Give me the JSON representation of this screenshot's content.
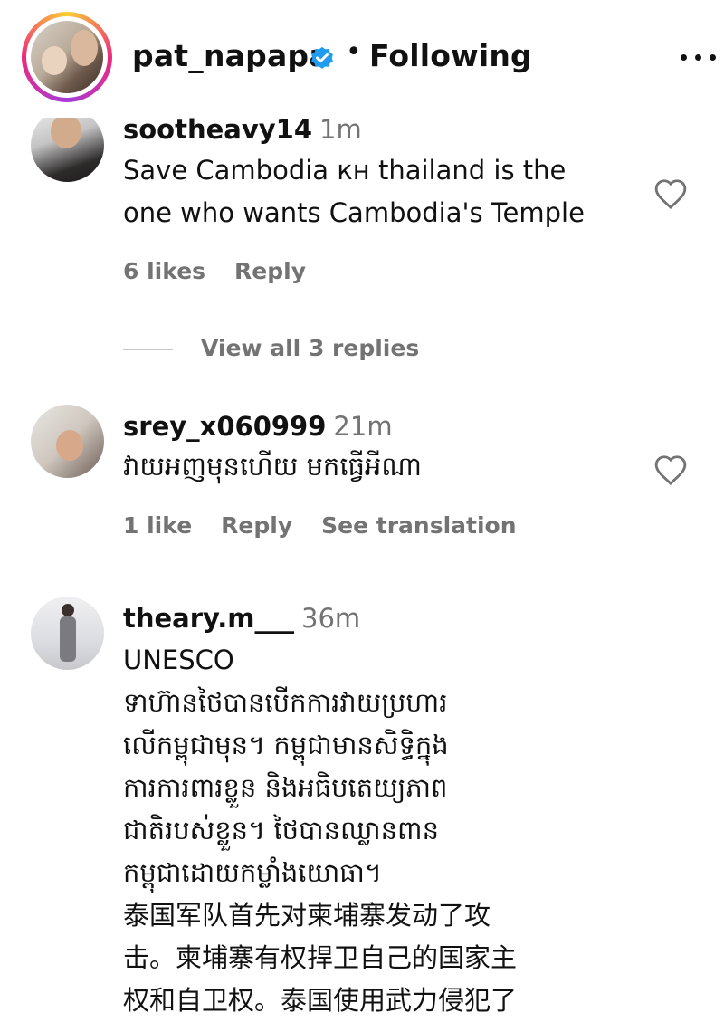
{
  "header": {
    "username": "pat_napapa",
    "separator": "•",
    "follow_status": "Following"
  },
  "comments": [
    {
      "username": "sootheavy14",
      "time": "1m",
      "text": "Save Cambodia кн thailand is the\none who wants Cambodia's Temple",
      "likes": "6 likes",
      "reply": "Reply",
      "view_replies": "View all 3 replies"
    },
    {
      "username": "srey_x060999",
      "time": "21m",
      "text": "វាយអញមុនហើយ មកធ្វើអីណា",
      "likes": "1 like",
      "reply": "Reply",
      "translation": "See translation"
    },
    {
      "username": "theary.m___",
      "time": "36m",
      "text": "UNESCO\nទាហ៊ានថៃបានបើកការវាយប្រហារ\nលើកម្ពុជាមុន។ កម្ពុជាមានសិទ្ធិក្នុង\nការការពារខ្លួន និងអធិបតេយ្យភាព\nជាតិរបស់ខ្លួន។ ថៃបានឈ្លានពាន\nកម្ពុជាដោយកម្លាំងយោធា។\n泰国军队首先对柬埔寨发动了攻\n击。柬埔寨有权捍卫自己的国家主\n权和自卫权。泰国使用武力侵犯了"
    }
  ],
  "colors": {
    "verified": "#1f9bf0",
    "secondary_text": "#737373",
    "primary_text": "#111111"
  }
}
